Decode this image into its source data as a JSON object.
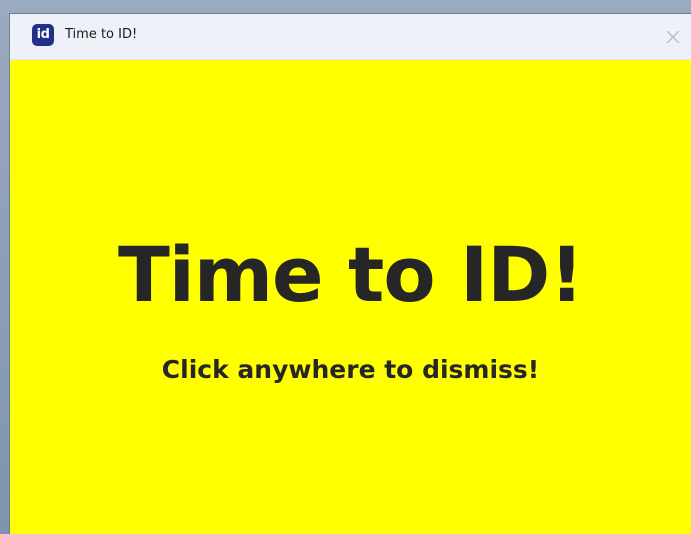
{
  "window": {
    "title": "Time to ID!",
    "app_icon_text": "id",
    "app_icon_color": "#23308a",
    "close_icon": "close-icon"
  },
  "content": {
    "background_color": "#ffff00",
    "headline": "Time to ID!",
    "subline": "Click anywhere to dismiss!"
  }
}
